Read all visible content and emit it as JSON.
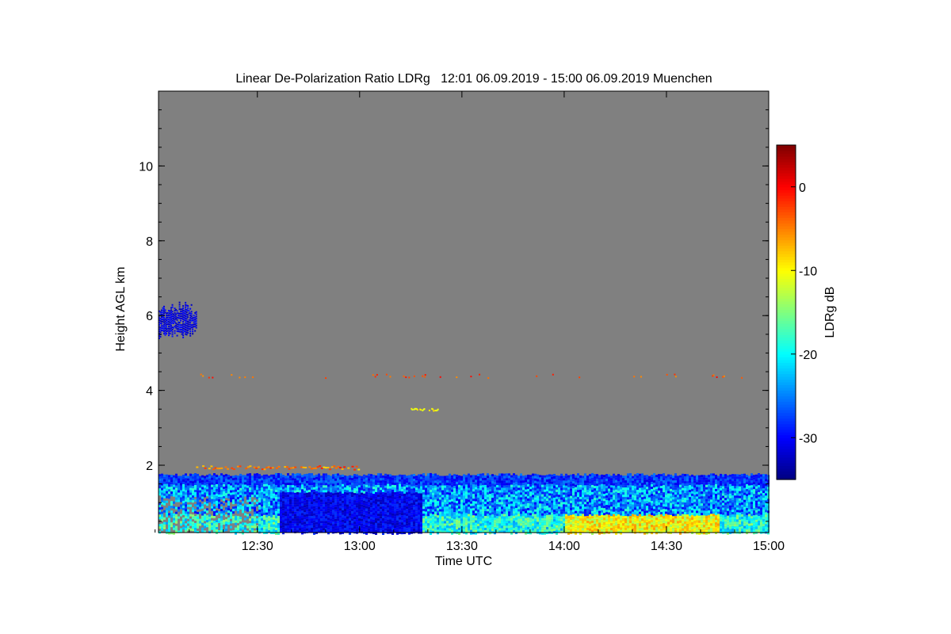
{
  "chart_data": {
    "type": "heatmap",
    "title": "Linear De-Polarization Ratio LDRg   12:01 06.09.2019 - 15:00 06.09.2019 Muenchen",
    "xlabel": "Time UTC",
    "ylabel": "Height AGL km",
    "x_range": [
      "12:01",
      "15:00"
    ],
    "x_ticks": [
      "12:30",
      "13:00",
      "13:30",
      "14:00",
      "14:30",
      "15:00"
    ],
    "ylim": [
      0.2,
      12.0
    ],
    "y_ticks": [
      "2",
      "4",
      "6",
      "8",
      "10"
    ],
    "colorbar": {
      "label": "LDRg dB",
      "range": [
        -35,
        5
      ],
      "ticks": [
        "0",
        "-10",
        "-20",
        "-30"
      ],
      "colormap": "jet"
    },
    "background_color": "#808080",
    "features": [
      {
        "desc": "aerosol layer",
        "t_start": "12:01",
        "t_end": "15:00",
        "h_bottom": 0.2,
        "h_top": 1.75,
        "ldr_db_range": [
          -33,
          -10
        ]
      },
      {
        "desc": "cloud",
        "t_start": "12:01",
        "t_end": "12:12",
        "h_bottom": 5.4,
        "h_top": 6.4,
        "ldr_db": -31
      },
      {
        "desc": "layer top",
        "t_start": "12:12",
        "t_end": "13:00",
        "h": 1.95,
        "ldr_db": -5
      },
      {
        "desc": "thin layer",
        "t_start": "13:15",
        "t_end": "13:23",
        "h": 3.5,
        "ldr_db": -10
      }
    ]
  }
}
